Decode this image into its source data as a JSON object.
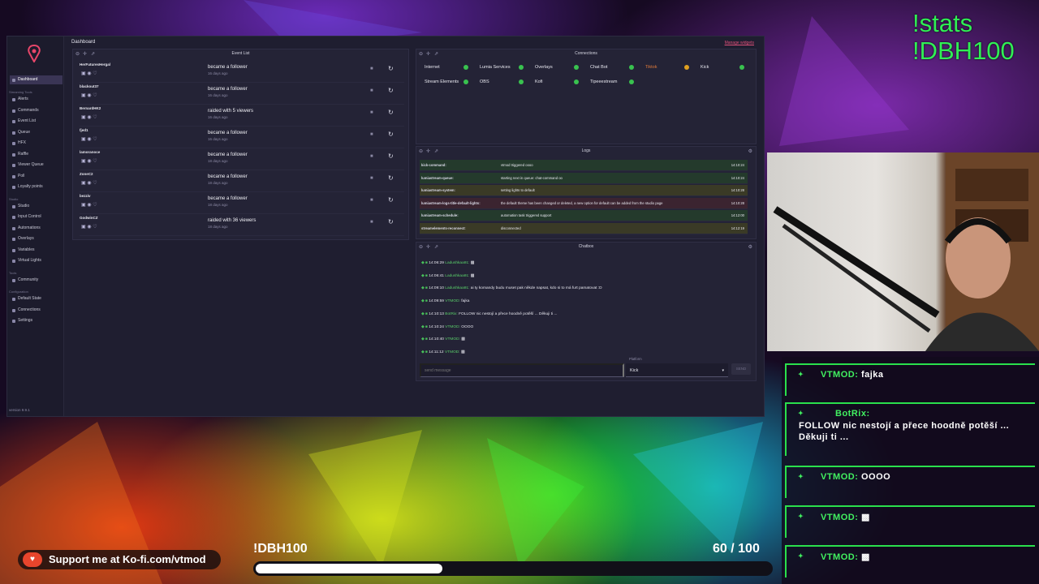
{
  "overlay": {
    "stats_cmd": "!stats",
    "dbh_cmd": "!DBH100",
    "kofi_text": "Support me at Ko-fi.com/vtmod",
    "goal": {
      "label": "!DBH100",
      "current": "60",
      "separator": "/",
      "target": "100",
      "progress": 0.6
    },
    "chat": [
      {
        "badge": "✦",
        "user": "VTMOD:",
        "text": "fajka"
      },
      {
        "badge": "✦",
        "user": "BotRix:",
        "text": "FOLLOW nic nestojí a přece hoodně potěší ... Děkuji ti ..."
      },
      {
        "badge": "✦",
        "user": "VTMOD:",
        "text": "OOOO"
      },
      {
        "badge": "✦",
        "user": "VTMOD:",
        "text": "▩"
      },
      {
        "badge": "✦",
        "user": "VTMOD:",
        "text": "▩"
      }
    ]
  },
  "dashboard": {
    "title": "Dashboard",
    "manage_widgets": "Manage widgets",
    "version": "version 9.9.1",
    "sidebar": {
      "items": [
        {
          "label": "Dashboard",
          "section": ""
        },
        {
          "label": "Alerts",
          "section": "Streaming Tools"
        },
        {
          "label": "Commands",
          "section": ""
        },
        {
          "label": "Event List",
          "section": ""
        },
        {
          "label": "Queue",
          "section": ""
        },
        {
          "label": "HFX",
          "section": ""
        },
        {
          "label": "Raffle",
          "section": ""
        },
        {
          "label": "Viewer Queue",
          "section": ""
        },
        {
          "label": "Poll",
          "section": ""
        },
        {
          "label": "Loyalty points",
          "section": ""
        },
        {
          "label": "Studio",
          "section": "Studio"
        },
        {
          "label": "Input Control",
          "section": ""
        },
        {
          "label": "Automations",
          "section": ""
        },
        {
          "label": "Overlays",
          "section": ""
        },
        {
          "label": "Variables",
          "section": ""
        },
        {
          "label": "Virtual Lights",
          "section": ""
        },
        {
          "label": "Community",
          "section": "Tools"
        },
        {
          "label": "Default State",
          "section": "Configuration"
        },
        {
          "label": "Connections",
          "section": ""
        },
        {
          "label": "Settings",
          "section": ""
        }
      ]
    },
    "event_list": {
      "title": "Event List",
      "events": [
        {
          "name": "HerFuturesHergal",
          "message": "became a follower",
          "time": "16 days ago"
        },
        {
          "name": "blackout37",
          "message": "became a follower",
          "time": "16 days ago"
        },
        {
          "name": "BernardHK2",
          "message": "raided with 5 viewers",
          "time": "16 days ago"
        },
        {
          "name": "fjed1",
          "message": "became a follower",
          "time": "16 days ago"
        },
        {
          "name": "lamoranoce",
          "message": "became a follower",
          "time": "18 days ago"
        },
        {
          "name": "ZoneC2",
          "message": "became a follower",
          "time": "18 days ago"
        },
        {
          "name": "bezziv",
          "message": "became a follower",
          "time": "18 days ago"
        },
        {
          "name": "GodwinCZ",
          "message": "raided with 36 viewers",
          "time": "18 days ago"
        }
      ]
    },
    "connections": {
      "title": "Connections",
      "items": [
        {
          "label": "Internet",
          "status": "ok"
        },
        {
          "label": "Lumia Services",
          "status": "ok"
        },
        {
          "label": "Overlays",
          "status": "ok"
        },
        {
          "label": "Chat Bot",
          "status": "ok"
        },
        {
          "label": "Tiktok",
          "status": "warn"
        },
        {
          "label": "Kick",
          "status": "ok"
        },
        {
          "label": "Stream Elements",
          "status": "ok"
        },
        {
          "label": "OBS",
          "status": "ok"
        },
        {
          "label": "Kofi",
          "status": "ok"
        },
        {
          "label": "Tipeeestream",
          "status": "ok"
        }
      ]
    },
    "logs": {
      "title": "Logs",
      "rows": [
        {
          "key": "kick-command:",
          "msg": "vtmod triggered oooo",
          "time": "14:10:24",
          "color": "#243a2c"
        },
        {
          "key": "lumiastream-queue:",
          "msg": "starting next in queue: chat-command oo",
          "time": "14:10:24",
          "color": "#243a2c"
        },
        {
          "key": "lumiastream-system:",
          "msg": "setting lights to default",
          "time": "14:10:28",
          "color": "#3a3a26"
        },
        {
          "key": "lumiastream-logs-title-default-lights:",
          "msg": "the default theme has been changed or deleted, a new option for default can be added from the studio page",
          "time": "14:10:28",
          "color": "#3b2430"
        },
        {
          "key": "lumiastream-schedule:",
          "msg": "automation task triggered support",
          "time": "14:12:00",
          "color": "#243a2c"
        },
        {
          "key": "streamelements-reconnect:",
          "msg": "disconnected",
          "time": "14:12:19",
          "color": "#3a3a26"
        }
      ]
    },
    "chatbox": {
      "title": "Chatbox",
      "messages": [
        {
          "time": "14:06:29",
          "user": "Ladushkaa91:",
          "text": "▩"
        },
        {
          "time": "14:06:41",
          "user": "Ladushkaa91:",
          "text": "▩"
        },
        {
          "time": "14:09:10",
          "user": "Ladushkaa91:",
          "text": "ai ty komandy budu muset pak někde napsat, kdo si to má furt pamatovat :D"
        },
        {
          "time": "14:09:59",
          "user": "VTMOD:",
          "text": "fajka"
        },
        {
          "time": "14:10:13",
          "user": "BotRix:",
          "text": "FOLLOW nic nestojí a přece hoodně potěší ... Děkuji ti ..."
        },
        {
          "time": "14:10:24",
          "user": "VTMOD:",
          "text": "OOOO"
        },
        {
          "time": "14:10:40",
          "user": "VTMOD:",
          "text": "▩"
        },
        {
          "time": "14:11:12",
          "user": "VTMOD:",
          "text": "▩"
        }
      ],
      "input_placeholder": "send message",
      "platform_label": "Platform",
      "platform_value": "Kick",
      "send_label": "SEND"
    }
  }
}
